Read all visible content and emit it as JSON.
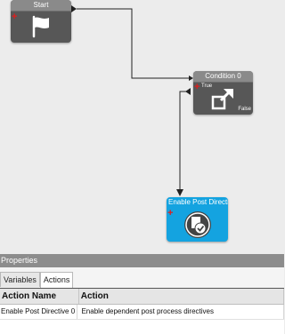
{
  "nodes": {
    "start": {
      "title": "Start",
      "icon": "flag-icon"
    },
    "condition": {
      "title": "Condition 0",
      "true_label": "True",
      "false_label": "False",
      "icon": "arrow-expand-icon"
    },
    "action": {
      "title": "Enable Post Directi",
      "icon": "document-check-icon"
    }
  },
  "properties": {
    "header": "Properties",
    "tabs": [
      "Variables",
      "Actions"
    ],
    "active_tab": "Actions",
    "columns": [
      "Action Name",
      "Action"
    ],
    "rows": [
      {
        "name": "Enable Post Directive 0",
        "action": "Enable dependent post process directives"
      }
    ]
  },
  "colors": {
    "canvas": "#ececec",
    "node_gray": "#575757",
    "node_blue": "#14a3e0",
    "connector": "#222222",
    "plus_red": "#e31b1b"
  }
}
